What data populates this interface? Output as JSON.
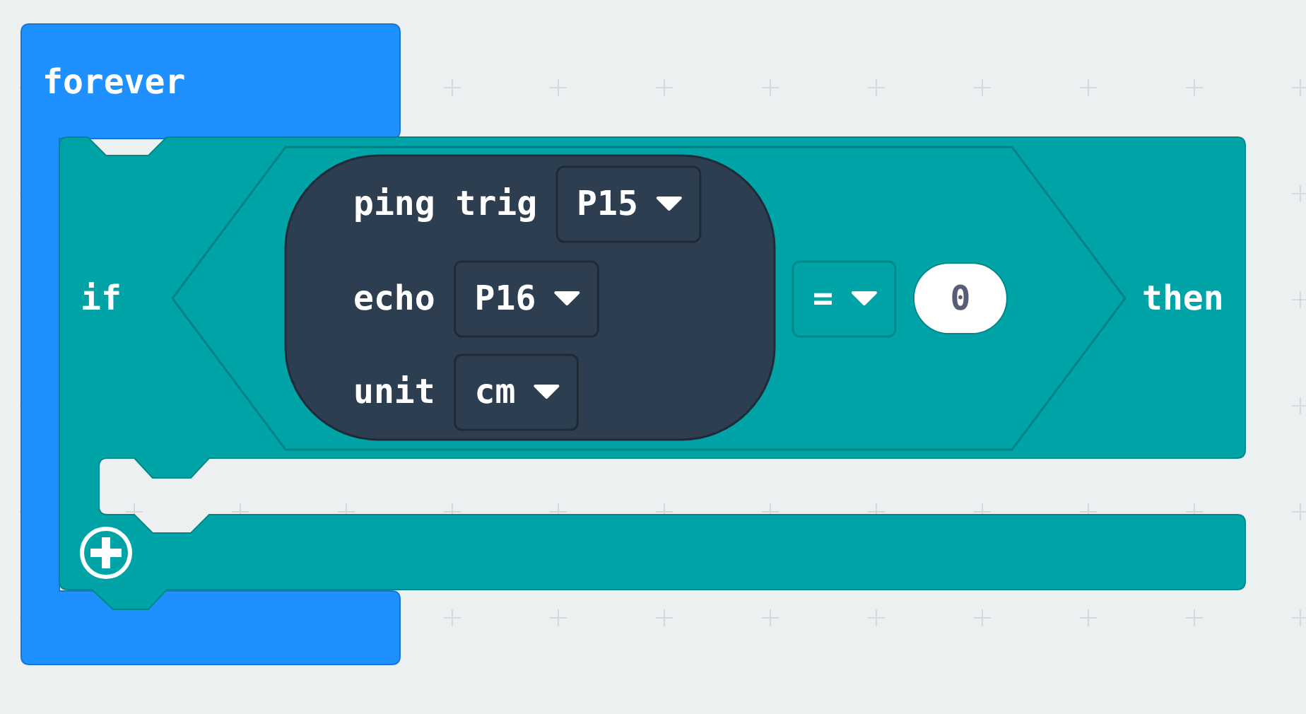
{
  "event_block": {
    "label": "forever"
  },
  "if_block": {
    "label": "if",
    "then_label": "then",
    "condition": {
      "sensor_segments": [
        {
          "label": "ping trig",
          "dropdown": "P15"
        },
        {
          "label": "echo",
          "dropdown": "P16"
        },
        {
          "label": "unit",
          "dropdown": "cm"
        }
      ],
      "operator": "=",
      "value": "0"
    }
  }
}
